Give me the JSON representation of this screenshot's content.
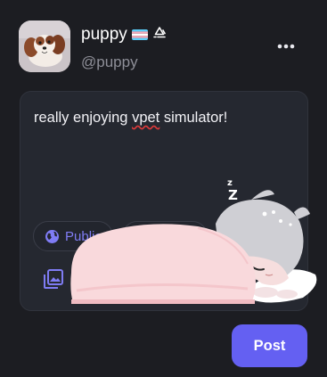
{
  "profile": {
    "display_name": "puppy",
    "handle": "@puppy",
    "flag_icon": "transgender-flag-icon",
    "symbol_icon": "recycle-symbol-icon"
  },
  "header": {
    "more_icon": "more-dots-icon"
  },
  "composer": {
    "text_before": "really enjoying ",
    "text_misspelled": "vpet",
    "text_after": " simulator!",
    "visibility_label": "Public",
    "visibility_icon": "globe-icon",
    "media_icon": "image-gallery-icon"
  },
  "pet": {
    "sleep_text": "Z Z",
    "blanket_color": "#f9d9dc",
    "hair_color": "#cfcfd4"
  },
  "actions": {
    "post_label": "Post"
  },
  "colors": {
    "background": "#1c1d22",
    "card": "#252830",
    "accent": "#6460f2",
    "chip_text": "#7f7cf4"
  }
}
